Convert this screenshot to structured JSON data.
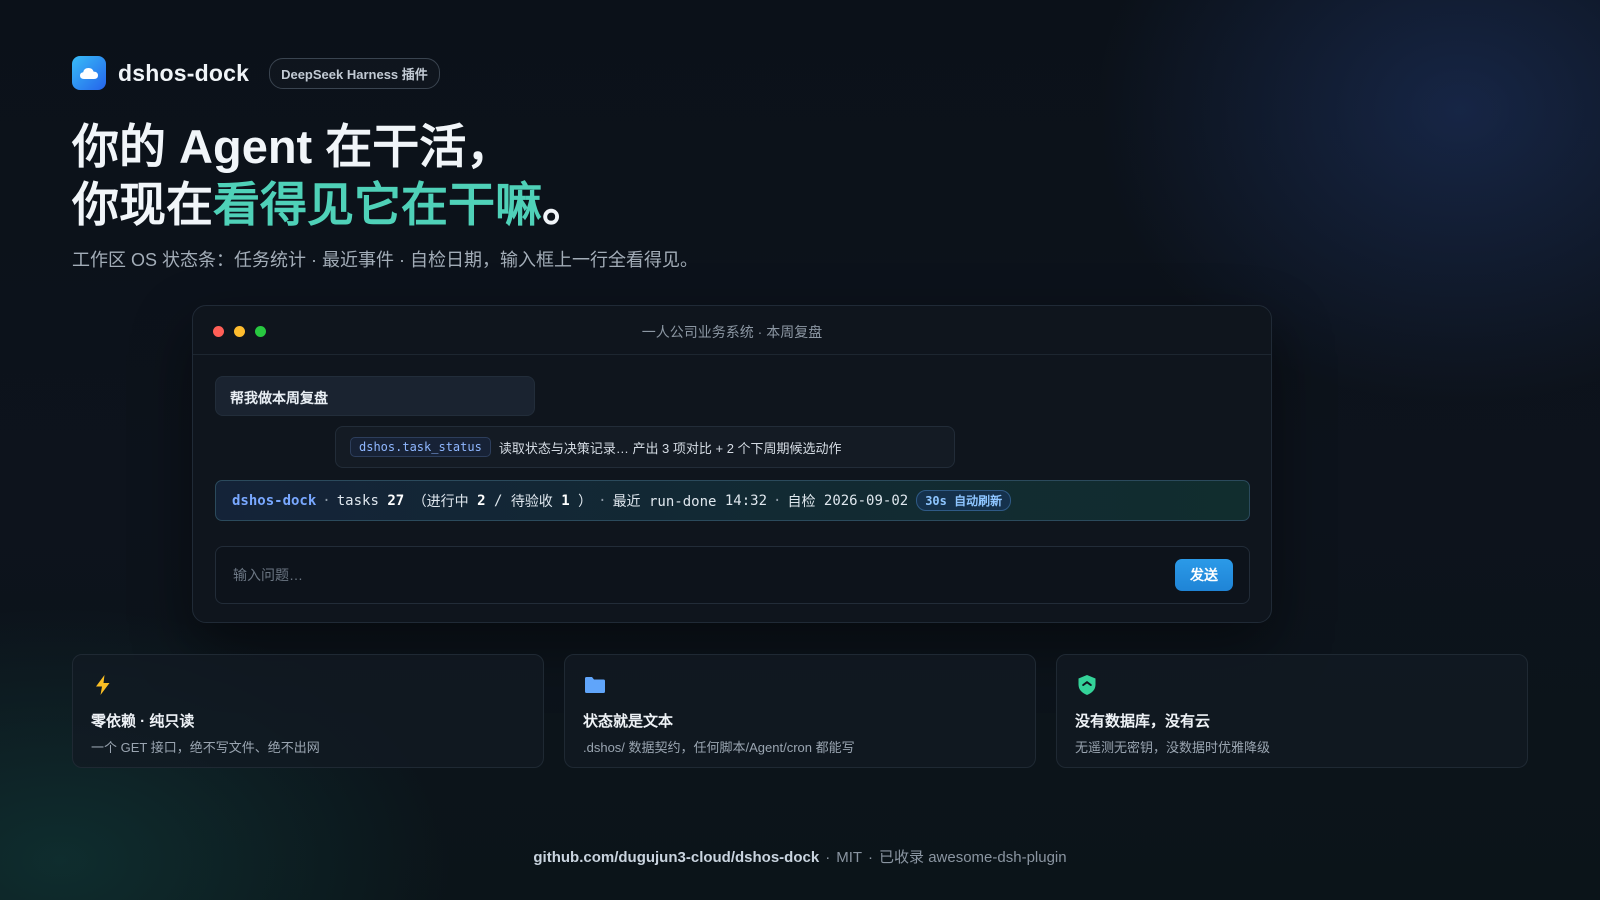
{
  "brand": {
    "name": "dshos-dock",
    "badge": "DeepSeek Harness 插件",
    "logo_icon": "cloud-icon"
  },
  "hero": {
    "line1": "你的 Agent 在干活，",
    "line2_prefix": "你现在",
    "line2_accent": "看得见它在干嘛",
    "line2_suffix": "。",
    "subtitle": "工作区 OS 状态条：任务统计 · 最近事件 · 自检日期，输入框上一行全看得见。",
    "accent_color": "#4fd1b8"
  },
  "window": {
    "title": "一人公司业务系统 · 本周复盘",
    "user_message": "帮我做本周复盘",
    "tool_call": {
      "tag": "dshos.task_status",
      "text": "读取状态与决策记录… 产出 3 项对比 + 2 个下周期候选动作"
    },
    "dock_bar": {
      "name": "dshos-dock",
      "sep": "·",
      "tasks_label": "tasks",
      "tasks_total": "27",
      "in_progress_label": "（进行中",
      "in_progress": "2",
      "slash": "/",
      "pending_label": "待验收",
      "pending": "1",
      "close_paren": "）",
      "recent_label": "最近 run-done",
      "recent_time": "14:32",
      "check_label": "自检",
      "check_date": "2026-09-02",
      "refresh_chip": "30s 自动刷新"
    },
    "input": {
      "placeholder": "输入问题…",
      "value": ""
    },
    "send_label": "发送"
  },
  "features": [
    {
      "icon": "lightning-icon",
      "icon_color": "#fbbf24",
      "title": "零依赖 · 纯只读",
      "desc": "一个 GET 接口，绝不写文件、绝不出网"
    },
    {
      "icon": "folder-icon",
      "icon_color": "#60a5fa",
      "title": "状态就是文本",
      "desc": ".dshos/ 数据契约，任何脚本/Agent/cron 都能写"
    },
    {
      "icon": "shield-icon",
      "icon_color": "#34d399",
      "title": "没有数据库，没有云",
      "desc": "无遥测无密钥，没数据时优雅降级"
    }
  ],
  "footer": {
    "repo": "github.com/dugujun3-cloud/dshos-dock",
    "sep": "·",
    "license": "MIT",
    "listed": "已收录 awesome-dsh-plugin"
  }
}
